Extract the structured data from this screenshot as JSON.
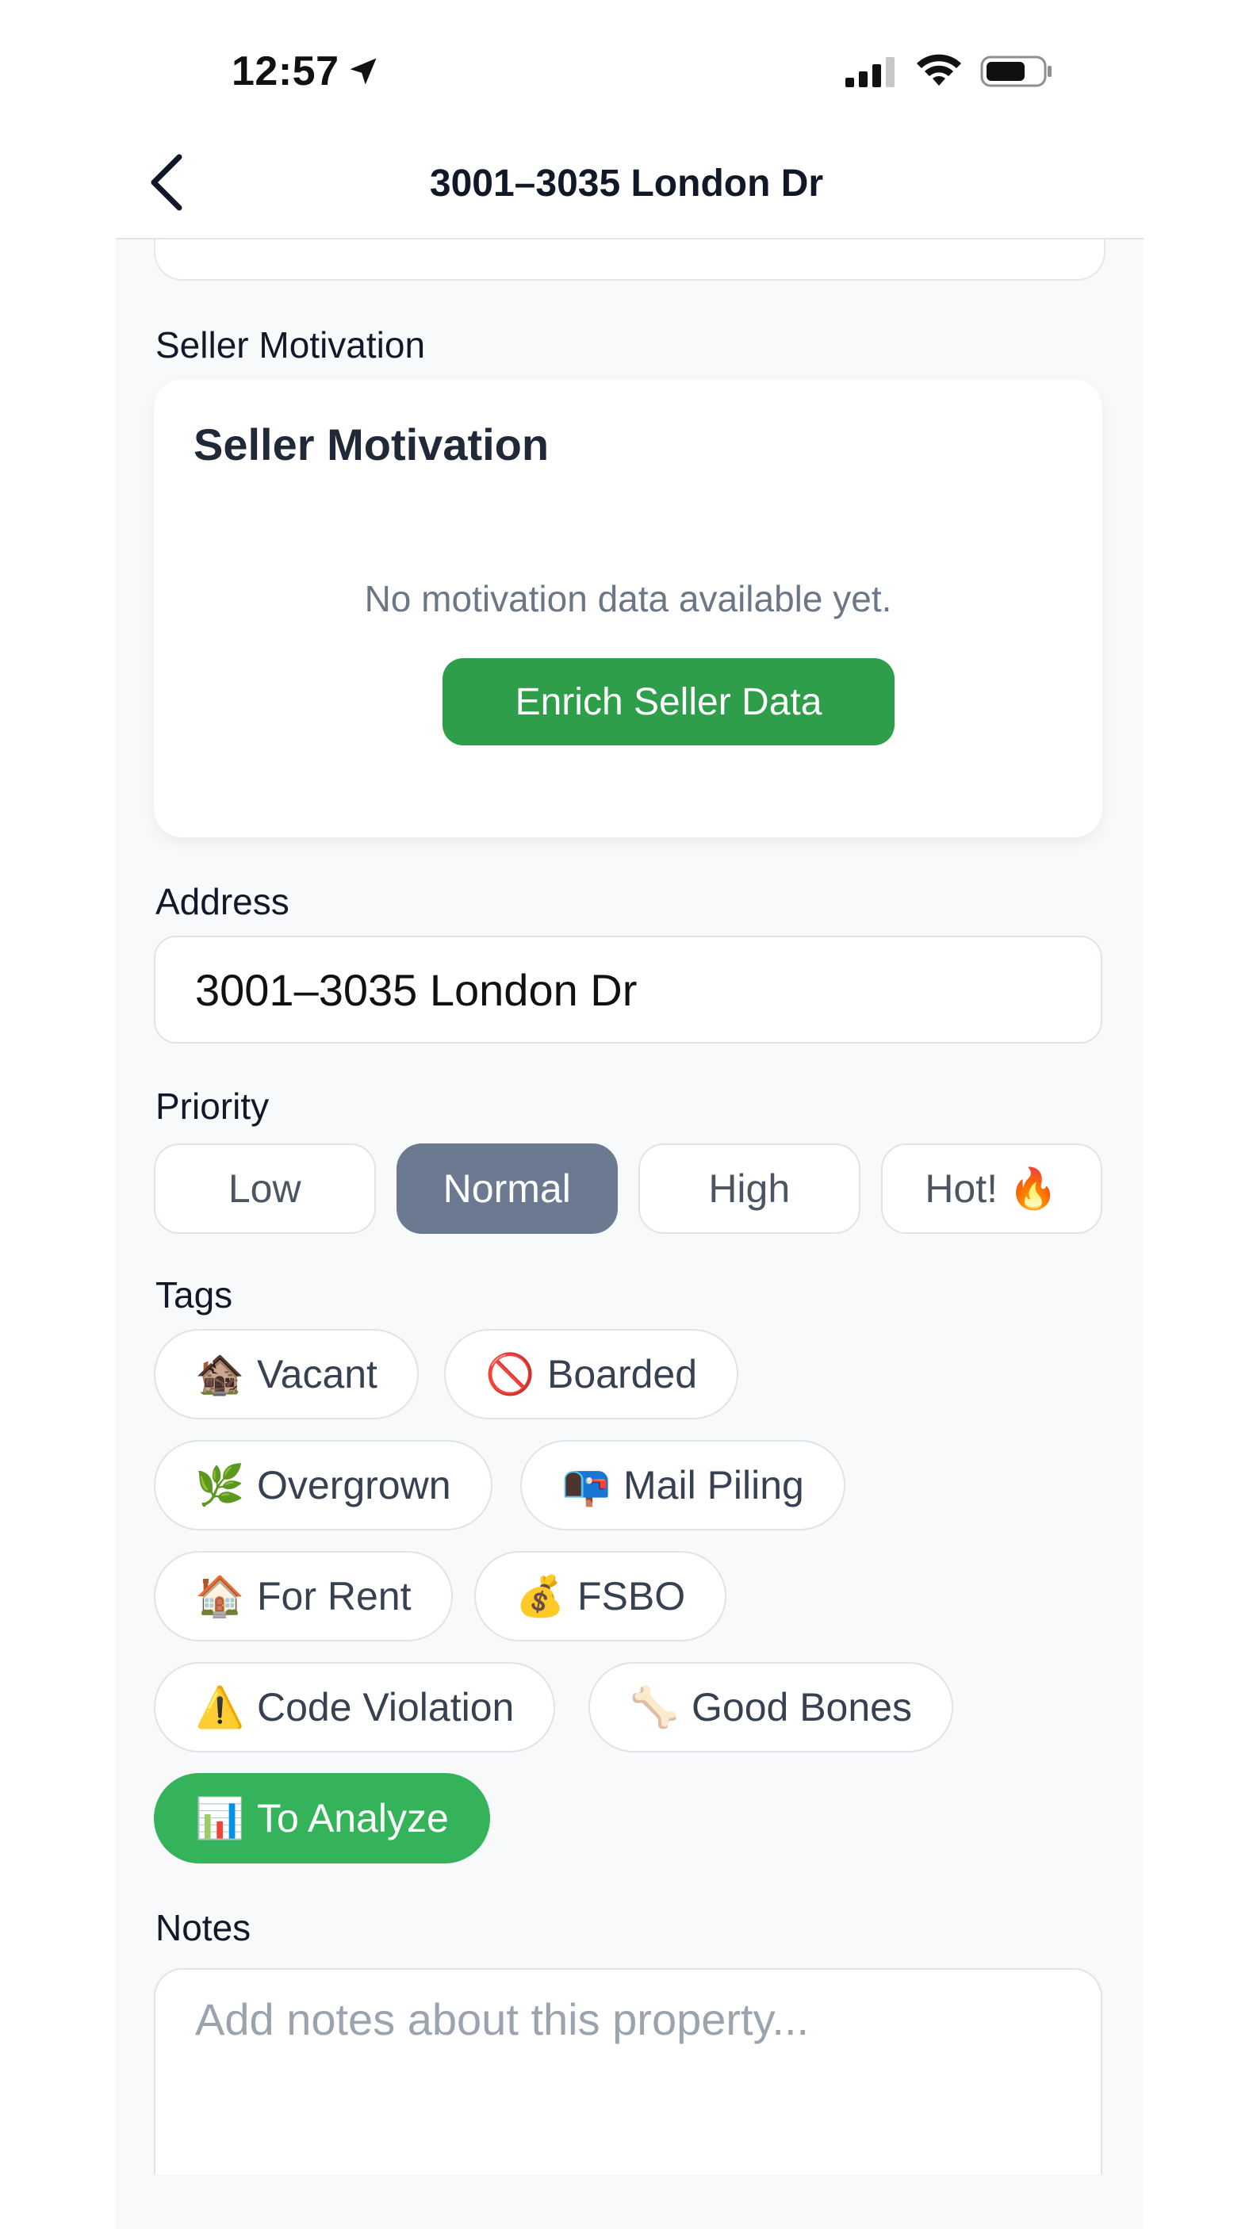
{
  "status": {
    "time": "12:57"
  },
  "nav": {
    "title": "3001–3035 London Dr"
  },
  "seller_motivation": {
    "section_label": "Seller Motivation",
    "card_title": "Seller Motivation",
    "empty_text": "No motivation data available yet.",
    "button_label": "Enrich Seller Data"
  },
  "address": {
    "label": "Address",
    "value": "3001–3035 London Dr"
  },
  "priority": {
    "label": "Priority",
    "options": [
      {
        "label": "Low",
        "selected": false
      },
      {
        "label": "Normal",
        "selected": true
      },
      {
        "label": "High",
        "selected": false
      },
      {
        "label": "Hot! 🔥",
        "selected": false
      }
    ]
  },
  "tags": {
    "label": "Tags",
    "items": [
      {
        "icon": "🏚️",
        "icon_name": "derelict-house-icon",
        "label": "Vacant",
        "selected": false
      },
      {
        "icon": "🚫",
        "icon_name": "prohibited-icon",
        "label": "Boarded",
        "selected": false
      },
      {
        "icon": "🌿",
        "icon_name": "herb-icon",
        "label": "Overgrown",
        "selected": false
      },
      {
        "icon": "📭",
        "icon_name": "mailbox-icon",
        "label": "Mail Piling",
        "selected": false
      },
      {
        "icon": "🏠",
        "icon_name": "house-icon",
        "label": "For Rent",
        "selected": false
      },
      {
        "icon": "💰",
        "icon_name": "money-bag-icon",
        "label": "FSBO",
        "selected": false
      },
      {
        "icon": "⚠️",
        "icon_name": "warning-icon",
        "label": "Code Violation",
        "selected": false
      },
      {
        "icon": "🦴",
        "icon_name": "bone-icon",
        "label": "Good Bones",
        "selected": false
      },
      {
        "icon": "📊",
        "icon_name": "bar-chart-icon",
        "label": "To Analyze",
        "selected": true
      }
    ]
  },
  "notes": {
    "label": "Notes",
    "placeholder": "Add notes about this property..."
  },
  "colors": {
    "accent_green": "#2e9e4a",
    "selected_tag": "#34b35a",
    "selected_priority": "#6b7a90"
  }
}
